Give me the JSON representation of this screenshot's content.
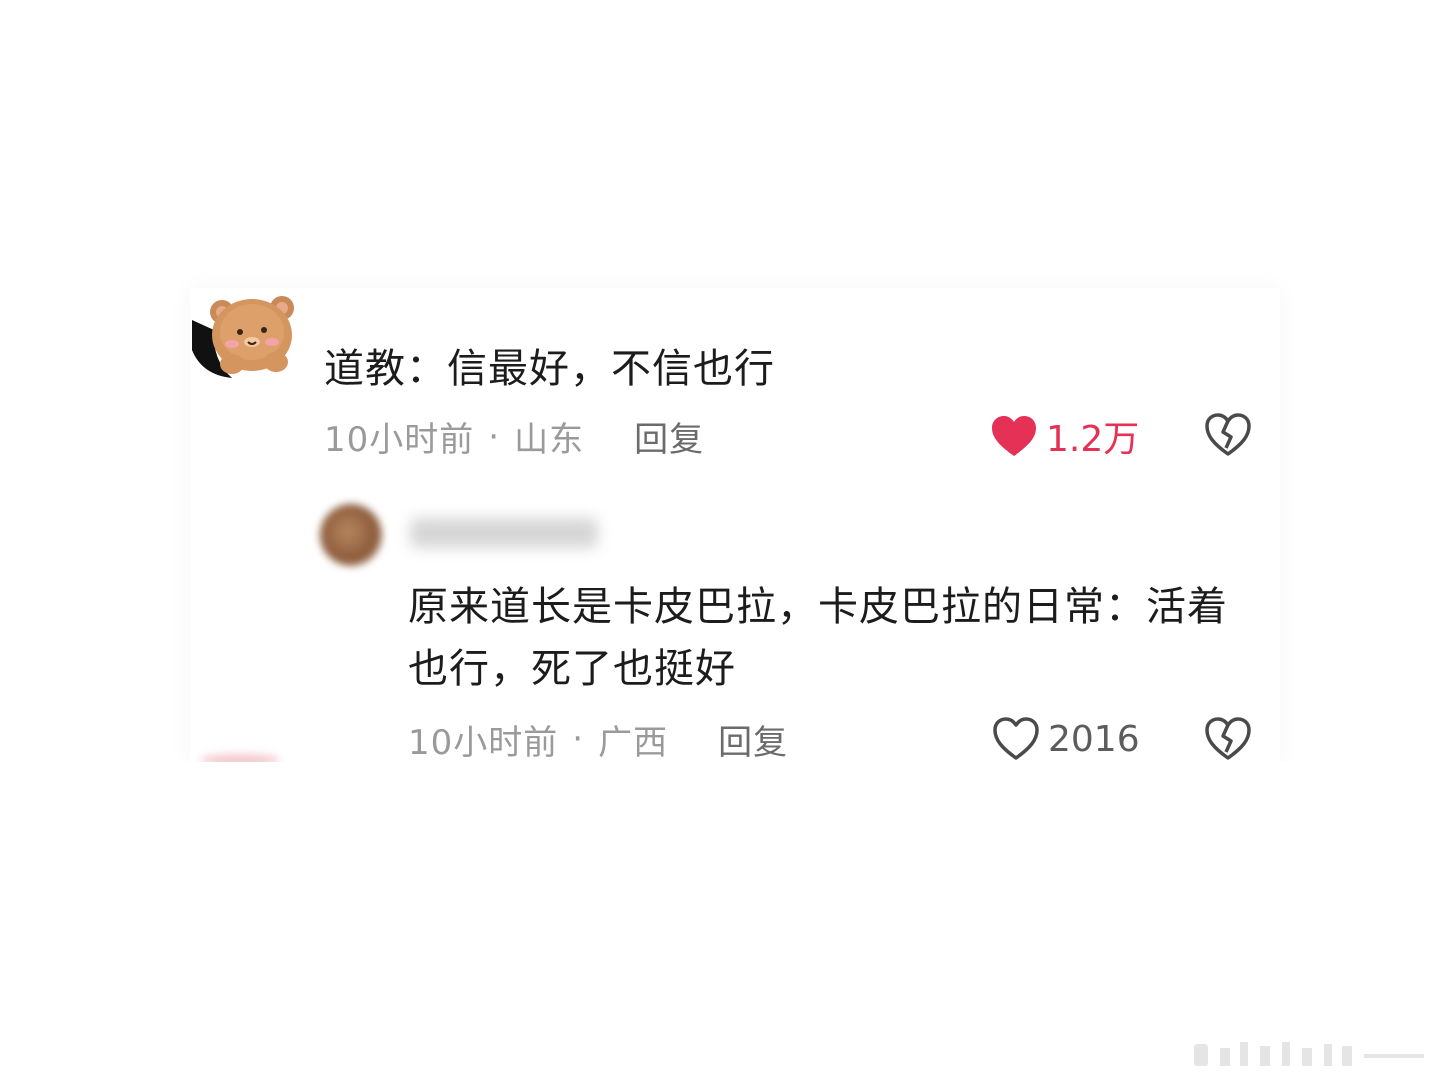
{
  "comments": [
    {
      "text": "道教：信最好，不信也行",
      "time": "10小时前",
      "location": "山东",
      "separator": "·",
      "reply_label": "回复",
      "like_count": "1.2万",
      "liked": true
    },
    {
      "text": "原来道长是卡皮巴拉，卡皮巴拉的日常：活着也行，死了也挺好",
      "time": "10小时前",
      "location": "广西",
      "separator": "·",
      "reply_label": "回复",
      "like_count": "2016",
      "liked": false
    }
  ],
  "colors": {
    "like_active": "#e63157",
    "meta_text": "#9a9a9a",
    "body_text": "#1c1c1c"
  },
  "icons": [
    "heart-icon",
    "broken-heart-icon",
    "bear-avatar"
  ]
}
